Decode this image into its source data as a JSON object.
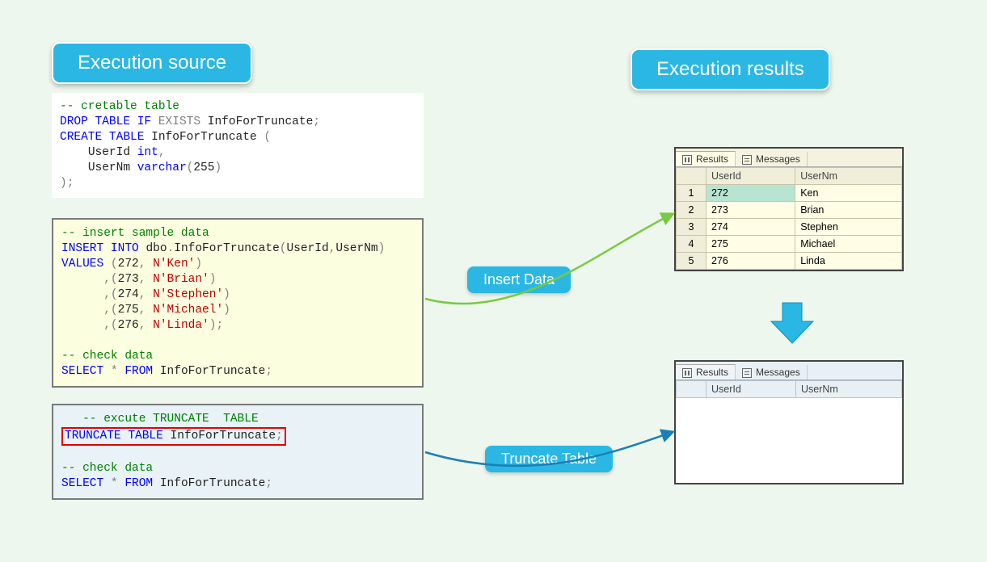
{
  "titles": {
    "source": "Execution source",
    "results": "Execution results"
  },
  "labels": {
    "insert": "Insert Data",
    "truncate": "Truncate Table"
  },
  "grid": {
    "tabs": {
      "results": "Results",
      "messages": "Messages"
    },
    "columns": [
      "UserId",
      "UserNm"
    ],
    "rows": [
      {
        "n": "1",
        "UserId": "272",
        "UserNm": "Ken"
      },
      {
        "n": "2",
        "UserId": "273",
        "UserNm": "Brian"
      },
      {
        "n": "3",
        "UserId": "274",
        "UserNm": "Stephen"
      },
      {
        "n": "4",
        "UserId": "275",
        "UserNm": "Michael"
      },
      {
        "n": "5",
        "UserId": "276",
        "UserNm": "Linda"
      }
    ]
  },
  "code1": {
    "l1": "-- cretable table",
    "l2a": "DROP",
    "l2b": "TABLE",
    "l2c": "IF",
    "l2d": "EXISTS",
    "l2e": "InfoForTruncate",
    "l3a": "CREATE",
    "l3b": "TABLE",
    "l3c": "InfoForTruncate",
    "l4a": "UserId",
    "l4b": "int",
    "l5a": "UserNm",
    "l5b": "varchar",
    "l5c": "255"
  },
  "code2": {
    "l1": "-- insert sample data",
    "l2a": "INSERT",
    "l2b": "INTO",
    "l2c": "dbo",
    "l2d": "InfoForTruncate",
    "l2e": "UserId",
    "l2f": "UserNm",
    "l3a": "VALUES",
    "l3b": "272",
    "l3c": "N'Ken'",
    "l4b": "273",
    "l4c": "N'Brian'",
    "l5b": "274",
    "l5c": "N'Stephen'",
    "l6b": "275",
    "l6c": "N'Michael'",
    "l7b": "276",
    "l7c": "N'Linda'",
    "l8": "-- check data",
    "l9a": "SELECT",
    "l9b": "FROM",
    "l9c": "InfoForTruncate"
  },
  "code3": {
    "l1": "-- excute TRUNCATE  TABLE",
    "l2a": "TRUNCATE",
    "l2b": "TABLE",
    "l2c": "InfoForTruncate",
    "l3": "-- check data",
    "l4a": "SELECT",
    "l4b": "FROM",
    "l4c": "InfoForTruncate"
  }
}
